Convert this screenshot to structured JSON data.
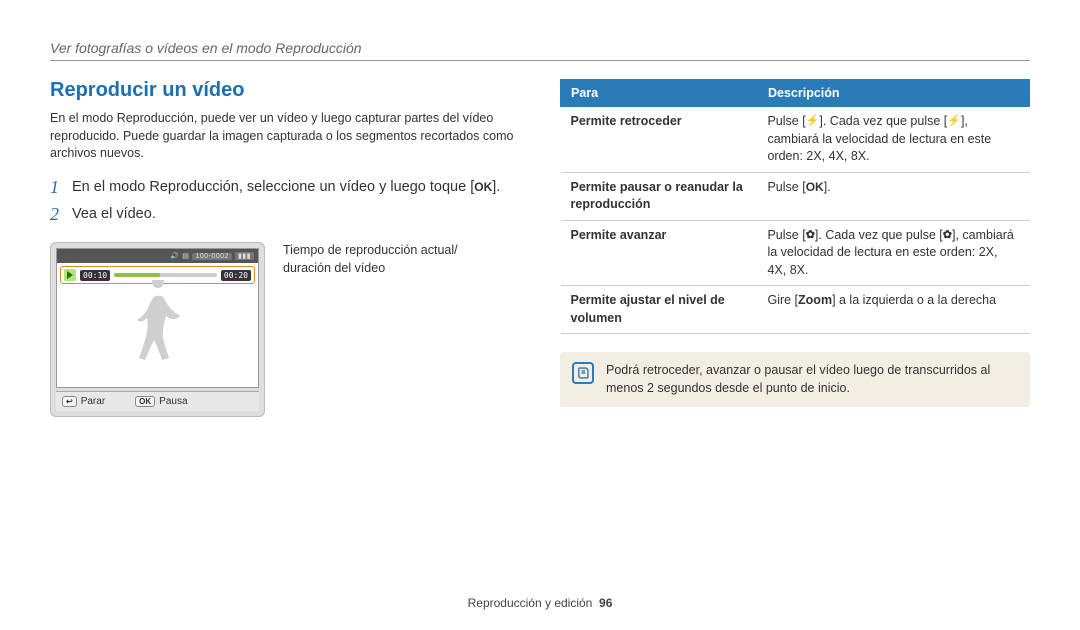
{
  "header": {
    "breadcrumb": "Ver fotografías o vídeos en el modo Reproducción"
  },
  "section": {
    "title": "Reproducir un vídeo",
    "intro": "En el modo Reproducción, puede ver un vídeo y luego capturar partes del vídeo reproducido. Puede guardar la imagen capturada o los segmentos recortados como archivos nuevos."
  },
  "steps": [
    {
      "num": "1",
      "text_before": "En el modo Reproducción, seleccione un vídeo y luego toque [",
      "icon": "OK",
      "text_after": "]."
    },
    {
      "num": "2",
      "text_before": "Vea el vídeo.",
      "icon": "",
      "text_after": ""
    }
  ],
  "camera": {
    "topbar_right1": "100-0002",
    "topbar_battery": "▮▮▮",
    "time_current": "00:10",
    "time_total": "00:20",
    "bottom_left_key": "↩",
    "bottom_left_label": "Parar",
    "bottom_right_key": "OK",
    "bottom_right_label": "Pausa"
  },
  "callout": {
    "text": "Tiempo de reproducción actual/ duración del vídeo"
  },
  "table": {
    "headers": {
      "col1": "Para",
      "col2": "Descripción"
    },
    "rows": [
      {
        "label": "Permite retroceder",
        "desc_pre": "Pulse [",
        "icon1": "⚡",
        "desc_mid": "]. Cada vez que pulse [",
        "icon2": "⚡",
        "desc_post": "], cambiará la velocidad de lectura en este orden: 2X, 4X, 8X."
      },
      {
        "label": "Permite pausar o reanudar la reproducción",
        "desc_pre": "Pulse [",
        "icon1": "OK",
        "desc_mid": "",
        "icon2": "",
        "desc_post": "]."
      },
      {
        "label": "Permite avanzar",
        "desc_pre": "Pulse [",
        "icon1": "✿",
        "desc_mid": "]. Cada vez que pulse [",
        "icon2": "✿",
        "desc_post": "], cambiará la velocidad de lectura en este orden: 2X, 4X, 8X."
      },
      {
        "label": "Permite ajustar el nivel de volumen",
        "desc_pre": "Gire [",
        "icon1": "",
        "bold": "Zoom",
        "desc_mid": "",
        "icon2": "",
        "desc_post": "] a la izquierda o a la derecha"
      }
    ]
  },
  "note": {
    "text": "Podrá retroceder, avanzar o pausar el vídeo luego de transcurridos al menos 2 segundos desde el punto de inicio."
  },
  "footer": {
    "section": "Reproducción y edición",
    "page": "96"
  }
}
